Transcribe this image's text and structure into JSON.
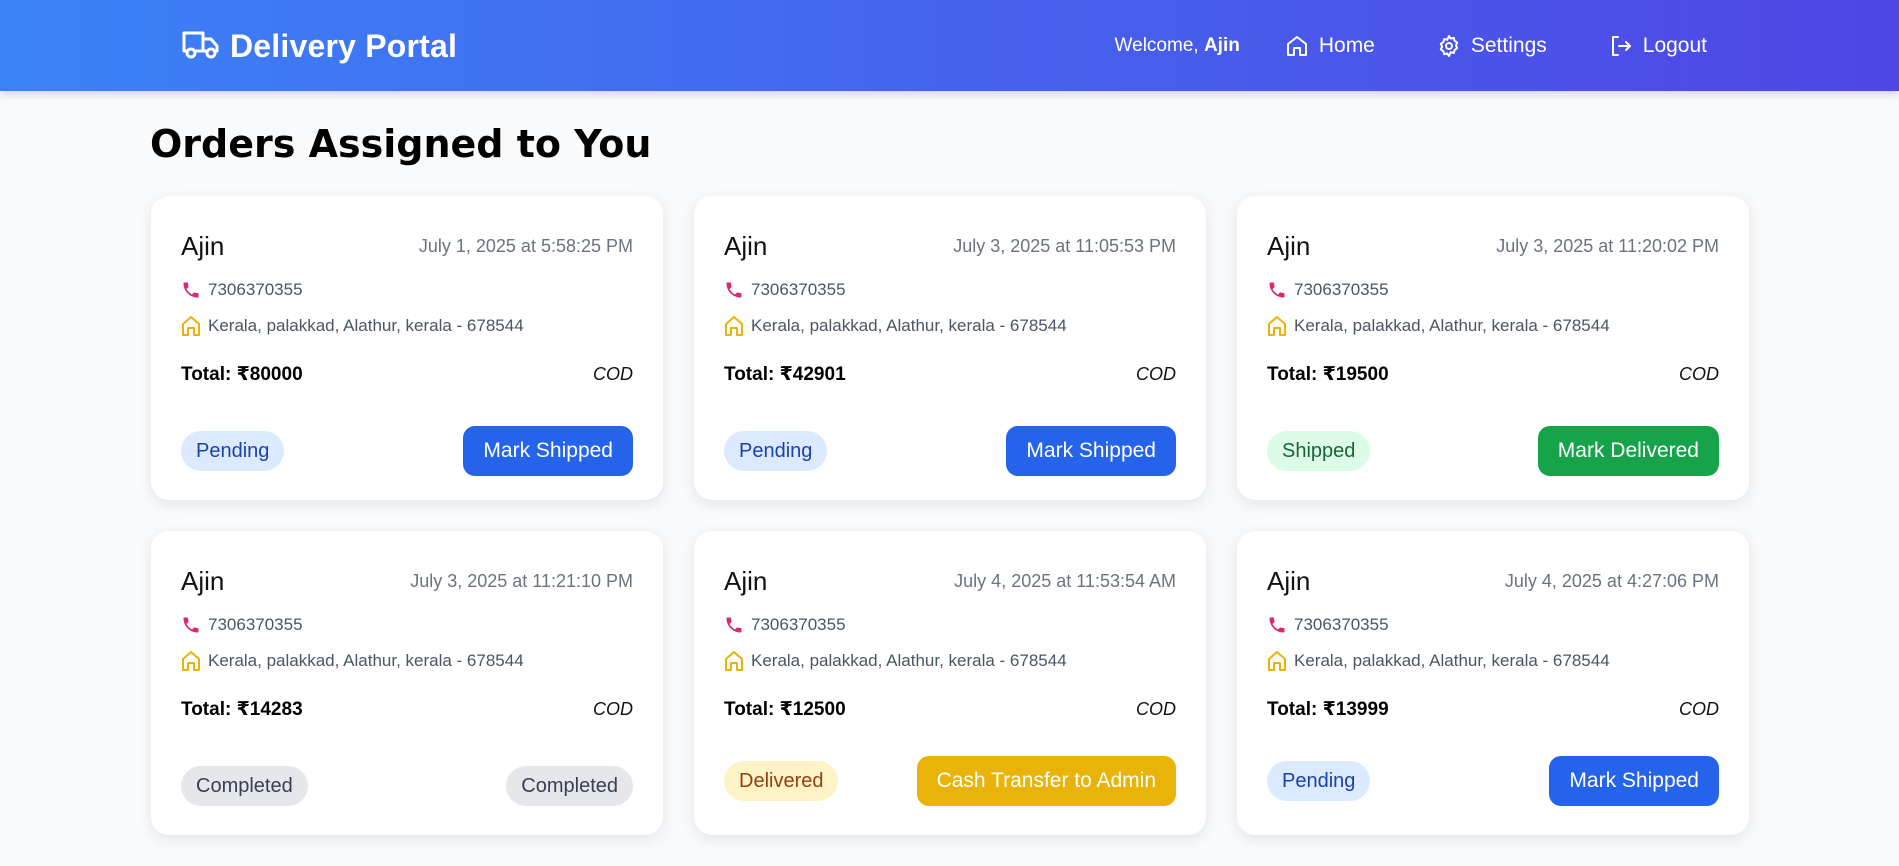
{
  "header": {
    "brand_title": "Delivery Portal",
    "welcome_prefix": "Welcome, ",
    "user_name": "Ajin",
    "nav": {
      "home": "Home",
      "settings": "Settings",
      "logout": "Logout"
    }
  },
  "page_title": "Orders Assigned to You",
  "orders": [
    {
      "name": "Ajin",
      "date": "July 1, 2025 at 5:58:25 PM",
      "phone": "7306370355",
      "address": "Kerala, palakkad, Alathur, kerala - 678544",
      "total": "Total: ₹80000",
      "payment": "COD",
      "status": "Pending",
      "action": "Mark Shipped"
    },
    {
      "name": "Ajin",
      "date": "July 3, 2025 at 11:05:53 PM",
      "phone": "7306370355",
      "address": "Kerala, palakkad, Alathur, kerala - 678544",
      "total": "Total: ₹42901",
      "payment": "COD",
      "status": "Pending",
      "action": "Mark Shipped"
    },
    {
      "name": "Ajin",
      "date": "July 3, 2025 at 11:20:02 PM",
      "phone": "7306370355",
      "address": "Kerala, palakkad, Alathur, kerala - 678544",
      "total": "Total: ₹19500",
      "payment": "COD",
      "status": "Shipped",
      "action": "Mark Delivered"
    },
    {
      "name": "Ajin",
      "date": "July 3, 2025 at 11:21:10 PM",
      "phone": "7306370355",
      "address": "Kerala, palakkad, Alathur, kerala - 678544",
      "total": "Total: ₹14283",
      "payment": "COD",
      "status": "Completed",
      "action": "Completed"
    },
    {
      "name": "Ajin",
      "date": "July 4, 2025 at 11:53:54 AM",
      "phone": "7306370355",
      "address": "Kerala, palakkad, Alathur, kerala - 678544",
      "total": "Total: ₹12500",
      "payment": "COD",
      "status": "Delivered",
      "action": "Cash Transfer to Admin"
    },
    {
      "name": "Ajin",
      "date": "July 4, 2025 at 4:27:06 PM",
      "phone": "7306370355",
      "address": "Kerala, palakkad, Alathur, kerala - 678544",
      "total": "Total: ₹13999",
      "payment": "COD",
      "status": "Pending",
      "action": "Mark Shipped"
    }
  ],
  "colors": {
    "header_gradient_start": "#3b82f6",
    "header_gradient_end": "#4f46e5",
    "pending_badge": "#dbeafe",
    "shipped_badge": "#dcfce7",
    "completed_badge": "#e5e7eb",
    "delivered_badge": "#fef3c7",
    "btn_blue": "#2563eb",
    "btn_green": "#16a34a",
    "btn_yellow": "#eab308"
  },
  "icons": {
    "brand": "truck-icon",
    "home": "home-icon",
    "settings": "gear-icon",
    "logout": "logout-icon",
    "phone": "phone-icon",
    "address": "house-icon"
  }
}
